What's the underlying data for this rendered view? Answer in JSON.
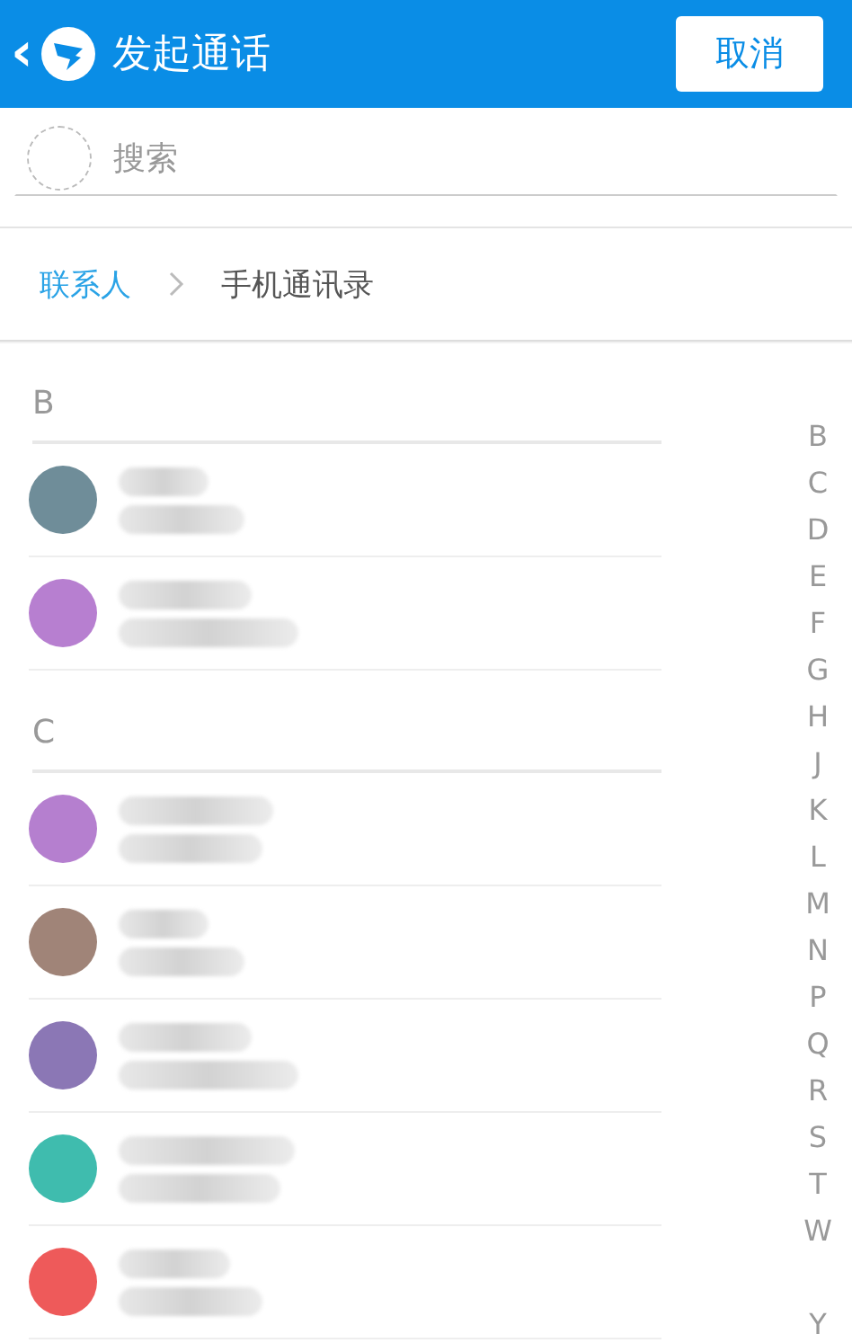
{
  "header": {
    "back": "‹",
    "title": "发起通话",
    "cancel": "取消"
  },
  "search": {
    "placeholder": "搜索"
  },
  "breadcrumb": [
    {
      "label": "联系人",
      "selected": false
    },
    {
      "label": "手机通讯录",
      "selected": true
    }
  ],
  "sections": [
    {
      "letter": "B",
      "contacts": [
        {
          "color": "#6f8d99"
        },
        {
          "color": "#b77fd0"
        }
      ]
    },
    {
      "letter": "C",
      "contacts": [
        {
          "color": "#b57fcf"
        },
        {
          "color": "#a08478"
        },
        {
          "color": "#8b77b5"
        },
        {
          "color": "#3fbcae"
        },
        {
          "color": "#ee5a5a"
        }
      ]
    }
  ],
  "index": [
    "B",
    "C",
    "D",
    "E",
    "F",
    "G",
    "H",
    "J",
    "K",
    "L",
    "M",
    "N",
    "P",
    "Q",
    "R",
    "S",
    "T",
    "W",
    "Y"
  ]
}
